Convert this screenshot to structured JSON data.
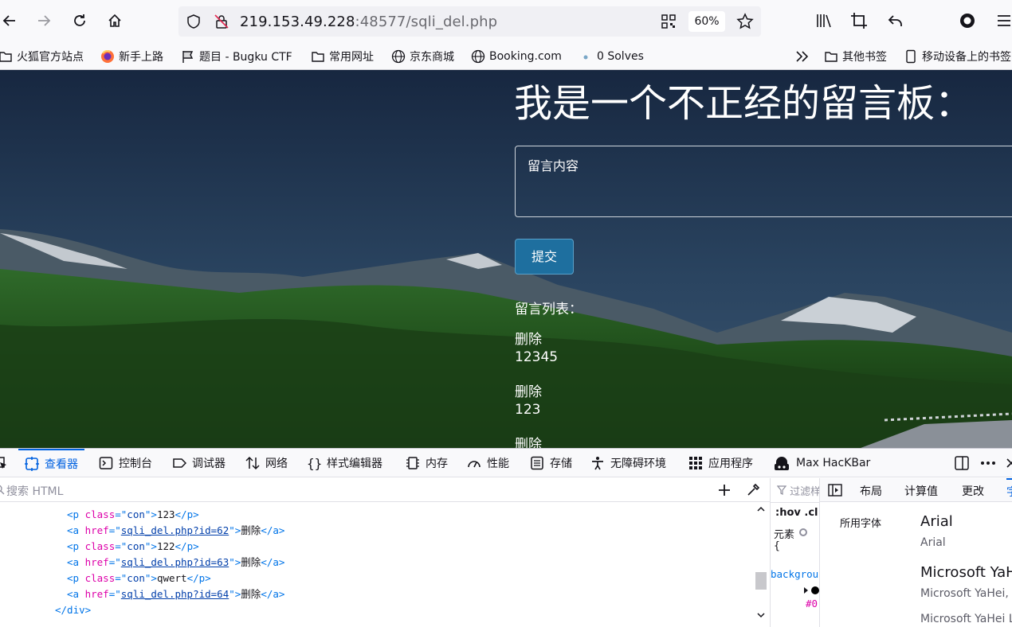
{
  "browser": {
    "url_host": "219.153.49.228",
    "url_rest": ":48577/sqli_del.php",
    "zoom": "60%",
    "icons": [
      "back-arrow-icon",
      "forward-arrow-icon",
      "reload-icon",
      "home-icon",
      "shield-icon",
      "insecure-lock-icon",
      "qr-code-icon",
      "star-icon",
      "library-icon",
      "crop-icon",
      "undo-icon",
      "profile-icon",
      "menu-icon"
    ]
  },
  "bookmarks": {
    "items": [
      "火狐官方站点",
      "新手上路",
      "题目 - Bugku CTF",
      "常用网址",
      "京东商城",
      "Booking.com",
      "0 Solves"
    ],
    "other": "其他书签",
    "mobile": "移动设备上的书签"
  },
  "page": {
    "title": "我是一个不正经的留言板：",
    "textarea_placeholder": "留言内容",
    "submit": "提交",
    "list_label": "留言列表：",
    "entries": [
      {
        "delete": "删除",
        "content": "12345"
      },
      {
        "delete": "删除",
        "content": "123"
      },
      {
        "delete": "删除",
        "content": ""
      }
    ]
  },
  "devtools": {
    "tabs": [
      "查看器",
      "控制台",
      "调试器",
      "网络",
      "样式编辑器",
      "内存",
      "性能",
      "存储",
      "无障碍环境",
      "应用程序",
      "Max HacKBar"
    ],
    "search_placeholder": "搜索 HTML",
    "code": [
      {
        "type": "p",
        "class": "con",
        "text": "123"
      },
      {
        "type": "a",
        "href": "sqli_del.php?id=62",
        "text": "删除"
      },
      {
        "type": "p",
        "class": "con",
        "text": "122"
      },
      {
        "type": "a",
        "href": "sqli_del.php?id=63",
        "text": "删除"
      },
      {
        "type": "p",
        "class": "con",
        "text": "qwert"
      },
      {
        "type": "a",
        "href": "sqli_del.php?id=64",
        "text": "删除"
      },
      {
        "type": "close",
        "text": "</div>"
      }
    ],
    "rules": {
      "filter": "过滤样",
      "hov": ":hov",
      "cls": ".cl",
      "element": "元素",
      "brace": "{",
      "prop": "backgrou",
      "val": "#0("
    },
    "side_tabs": [
      "布局",
      "计算值",
      "更改",
      "字"
    ],
    "fonts_label": "所用字体",
    "fonts": [
      {
        "name": "Arial",
        "detail": "Arial"
      },
      {
        "name": "Microsoft YaHei",
        "detail": "Microsoft YaHei,"
      },
      {
        "name": "",
        "detail": "Microsoft YaHei Li"
      }
    ]
  }
}
